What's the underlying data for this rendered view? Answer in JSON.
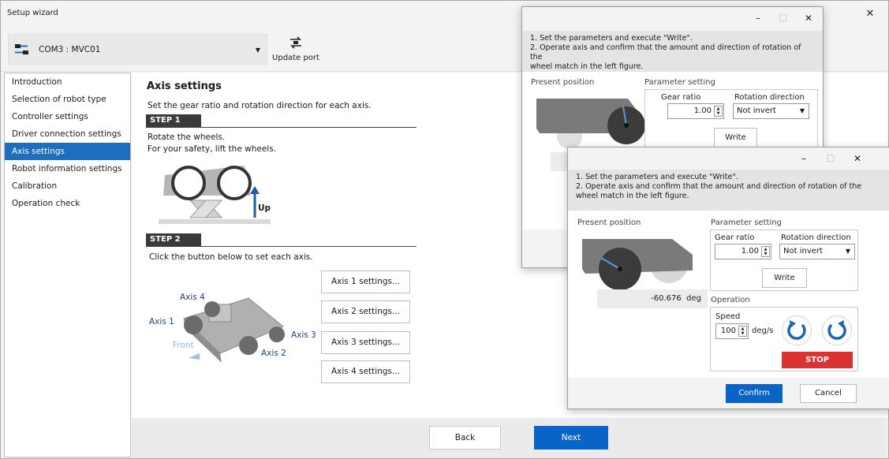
{
  "window": {
    "title": "Setup wizard",
    "min": "–",
    "max": "☐",
    "close": "✕"
  },
  "toolbar": {
    "port": "COM3 : MVC01",
    "update_port": "Update port"
  },
  "sidebar": {
    "items": [
      {
        "label": "Introduction"
      },
      {
        "label": "Selection of robot type"
      },
      {
        "label": "Controller settings"
      },
      {
        "label": "Driver connection settings"
      },
      {
        "label": "Axis settings"
      },
      {
        "label": "Robot information settings"
      },
      {
        "label": "Calibration"
      },
      {
        "label": "Operation check"
      }
    ]
  },
  "main": {
    "title": "Axis settings",
    "desc": "Set the gear ratio and rotation direction for each axis.",
    "step1": {
      "tag": "STEP 1",
      "line1": "Rotate the wheels.",
      "line2": "For your safety, lift the wheels.",
      "up": "Up"
    },
    "step2": {
      "tag": "STEP 2",
      "line1": "Click the button below to set each axis."
    },
    "axis_labels": {
      "a1": "Axis 1",
      "a2": "Axis 2",
      "a3": "Axis 3",
      "a4": "Axis 4",
      "front": "Front"
    },
    "axis_buttons": [
      "Axis 1 settings...",
      "Axis 2 settings...",
      "Axis 3 settings...",
      "Axis 4 settings..."
    ]
  },
  "footer": {
    "back": "Back",
    "next": "Next"
  },
  "dialog1": {
    "instr1": "1. Set the parameters and execute \"Write\".",
    "instr2": "2. Operate axis and confirm that the amount and direction of rotation of the",
    "instr3": "wheel match in the left figure.",
    "present_position": "Present position",
    "parameter_setting": "Parameter setting",
    "gear_ratio_label": "Gear ratio",
    "rotation_direction_label": "Rotation direction",
    "gear_ratio": "1.00",
    "rotation_direction": "Not invert",
    "write": "Write"
  },
  "dialog2": {
    "instr1": "1. Set the parameters and execute \"Write\".",
    "instr2": "2. Operate axis and confirm that the amount and direction of rotation of the",
    "instr3": "wheel match in the left figure.",
    "present_position": "Present position",
    "position_value": "-60.676",
    "position_unit": "deg",
    "parameter_setting": "Parameter setting",
    "gear_ratio_label": "Gear ratio",
    "rotation_direction_label": "Rotation direction",
    "gear_ratio": "1.00",
    "rotation_direction": "Not invert",
    "write": "Write",
    "operation": "Operation",
    "speed_label": "Speed",
    "speed": "100",
    "speed_unit": "deg/s",
    "stop": "STOP",
    "confirm": "Confirm",
    "cancel": "Cancel"
  },
  "colors": {
    "accent": "#1e6ec0",
    "primary_button": "#0a64c8",
    "stop": "#db3232"
  }
}
